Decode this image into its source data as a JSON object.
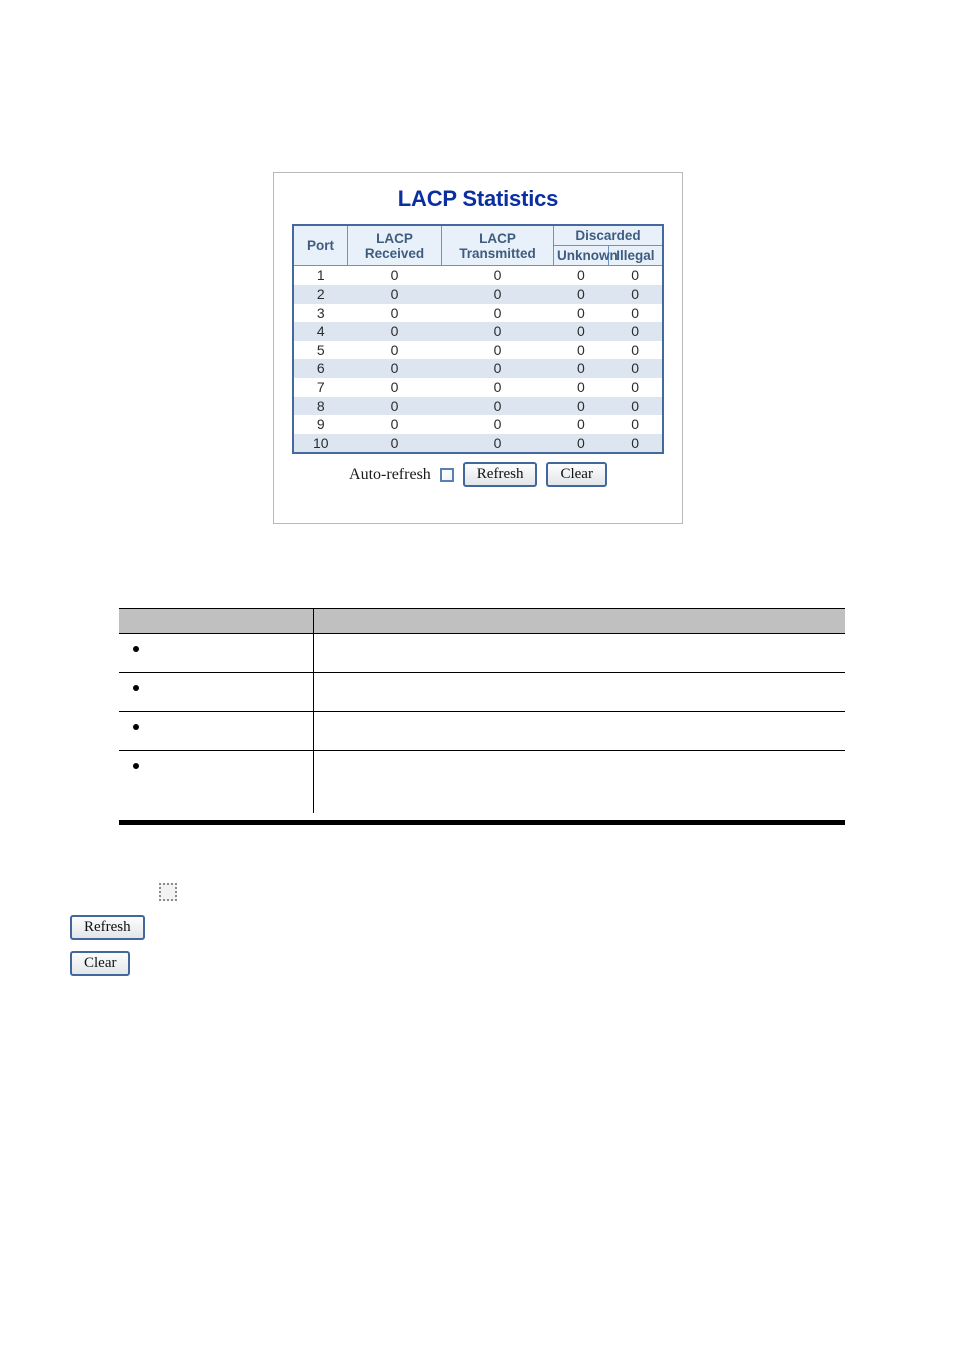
{
  "panel": {
    "title": "LACP Statistics",
    "table": {
      "headers": {
        "port": "Port",
        "lacp_received": "LACP Received",
        "lacp_transmitted": "LACP Transmitted",
        "discarded": "Discarded",
        "unknown": "Unknown",
        "illegal": "Illegal"
      },
      "rows": [
        {
          "port": "1",
          "received": "0",
          "transmitted": "0",
          "unknown": "0",
          "illegal": "0"
        },
        {
          "port": "2",
          "received": "0",
          "transmitted": "0",
          "unknown": "0",
          "illegal": "0"
        },
        {
          "port": "3",
          "received": "0",
          "transmitted": "0",
          "unknown": "0",
          "illegal": "0"
        },
        {
          "port": "4",
          "received": "0",
          "transmitted": "0",
          "unknown": "0",
          "illegal": "0"
        },
        {
          "port": "5",
          "received": "0",
          "transmitted": "0",
          "unknown": "0",
          "illegal": "0"
        },
        {
          "port": "6",
          "received": "0",
          "transmitted": "0",
          "unknown": "0",
          "illegal": "0"
        },
        {
          "port": "7",
          "received": "0",
          "transmitted": "0",
          "unknown": "0",
          "illegal": "0"
        },
        {
          "port": "8",
          "received": "0",
          "transmitted": "0",
          "unknown": "0",
          "illegal": "0"
        },
        {
          "port": "9",
          "received": "0",
          "transmitted": "0",
          "unknown": "0",
          "illegal": "0"
        },
        {
          "port": "10",
          "received": "0",
          "transmitted": "0",
          "unknown": "0",
          "illegal": "0"
        }
      ]
    },
    "controls": {
      "autorefresh_label": "Auto-refresh",
      "autorefresh_checked": false,
      "refresh_label": "Refresh",
      "clear_label": "Clear"
    }
  },
  "description_table": {
    "headers": {
      "col1": "",
      "col2": ""
    },
    "rows": [
      {
        "term": "",
        "description": ""
      },
      {
        "term": "",
        "description": ""
      },
      {
        "term": "",
        "description": ""
      },
      {
        "term": "",
        "description": ""
      }
    ]
  },
  "legend": {
    "checkbox_checked": false,
    "refresh_label": "Refresh",
    "clear_label": "Clear"
  },
  "colors": {
    "title_blue": "#0b2ea0",
    "table_border_blue": "#43699f",
    "header_bg": "#e8f1fa",
    "header_text": "#3f5c80",
    "row_stripe": "#dde6f0",
    "desc_header_gray": "#c0c0c0"
  }
}
